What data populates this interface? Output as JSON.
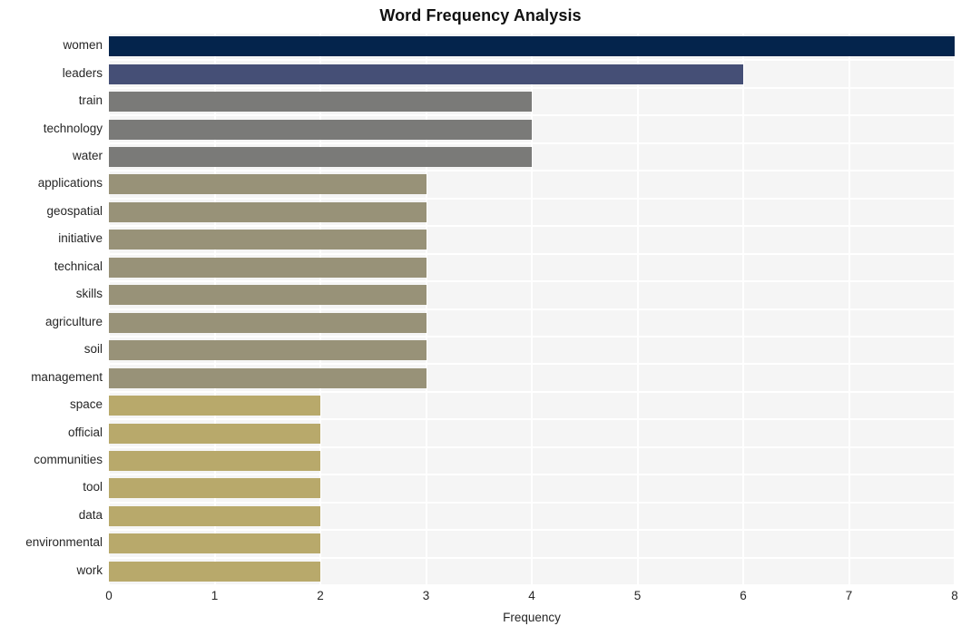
{
  "chart_data": {
    "type": "bar",
    "orientation": "horizontal",
    "title": "Word Frequency Analysis",
    "xlabel": "Frequency",
    "ylabel": "",
    "xlim": [
      0,
      8
    ],
    "xticks": [
      "0",
      "1",
      "2",
      "3",
      "4",
      "5",
      "6",
      "7",
      "8"
    ],
    "grid": true,
    "legend": "none",
    "categories": [
      "women",
      "leaders",
      "train",
      "technology",
      "water",
      "applications",
      "geospatial",
      "initiative",
      "technical",
      "skills",
      "agriculture",
      "soil",
      "management",
      "space",
      "official",
      "communities",
      "tool",
      "data",
      "environmental",
      "work"
    ],
    "values": [
      8,
      6,
      4,
      4,
      4,
      3,
      3,
      3,
      3,
      3,
      3,
      3,
      3,
      2,
      2,
      2,
      2,
      2,
      2,
      2
    ],
    "bar_colors": [
      "#04244c",
      "#454f76",
      "#7a7a78",
      "#7a7a78",
      "#7a7a78",
      "#989278",
      "#989278",
      "#989278",
      "#989278",
      "#989278",
      "#989278",
      "#989278",
      "#989278",
      "#b8a96b",
      "#b8a96b",
      "#b8a96b",
      "#b8a96b",
      "#b8a96b",
      "#b8a96b",
      "#b8a96b"
    ]
  },
  "style": {
    "plot_background": "#f5f5f5",
    "grid_color": "#ffffff",
    "figure_background": "#ffffff",
    "text_color": "#262626"
  }
}
